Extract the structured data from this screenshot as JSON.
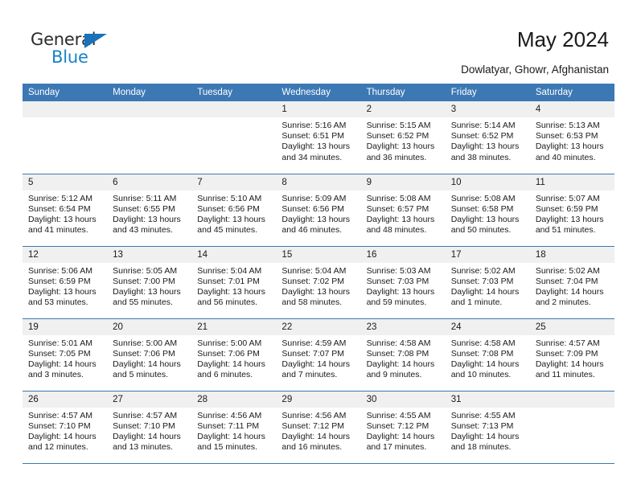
{
  "brand": {
    "name_top": "General",
    "name_bottom": "Blue",
    "accent_color": "#1683c8",
    "triangle_color": "#1972ba"
  },
  "header": {
    "title": "May 2024",
    "subtitle": "Dowlatyar, Ghowr, Afghanistan"
  },
  "calendar": {
    "header_bg": "#3c78b4",
    "daynum_bg": "#f0f0f0",
    "weekday_headers": [
      "Sunday",
      "Monday",
      "Tuesday",
      "Wednesday",
      "Thursday",
      "Friday",
      "Saturday"
    ],
    "weeks": [
      [
        {
          "day": "",
          "lines": []
        },
        {
          "day": "",
          "lines": []
        },
        {
          "day": "",
          "lines": []
        },
        {
          "day": "1",
          "lines": [
            "Sunrise: 5:16 AM",
            "Sunset: 6:51 PM",
            "Daylight: 13 hours",
            "and 34 minutes."
          ]
        },
        {
          "day": "2",
          "lines": [
            "Sunrise: 5:15 AM",
            "Sunset: 6:52 PM",
            "Daylight: 13 hours",
            "and 36 minutes."
          ]
        },
        {
          "day": "3",
          "lines": [
            "Sunrise: 5:14 AM",
            "Sunset: 6:52 PM",
            "Daylight: 13 hours",
            "and 38 minutes."
          ]
        },
        {
          "day": "4",
          "lines": [
            "Sunrise: 5:13 AM",
            "Sunset: 6:53 PM",
            "Daylight: 13 hours",
            "and 40 minutes."
          ]
        }
      ],
      [
        {
          "day": "5",
          "lines": [
            "Sunrise: 5:12 AM",
            "Sunset: 6:54 PM",
            "Daylight: 13 hours",
            "and 41 minutes."
          ]
        },
        {
          "day": "6",
          "lines": [
            "Sunrise: 5:11 AM",
            "Sunset: 6:55 PM",
            "Daylight: 13 hours",
            "and 43 minutes."
          ]
        },
        {
          "day": "7",
          "lines": [
            "Sunrise: 5:10 AM",
            "Sunset: 6:56 PM",
            "Daylight: 13 hours",
            "and 45 minutes."
          ]
        },
        {
          "day": "8",
          "lines": [
            "Sunrise: 5:09 AM",
            "Sunset: 6:56 PM",
            "Daylight: 13 hours",
            "and 46 minutes."
          ]
        },
        {
          "day": "9",
          "lines": [
            "Sunrise: 5:08 AM",
            "Sunset: 6:57 PM",
            "Daylight: 13 hours",
            "and 48 minutes."
          ]
        },
        {
          "day": "10",
          "lines": [
            "Sunrise: 5:08 AM",
            "Sunset: 6:58 PM",
            "Daylight: 13 hours",
            "and 50 minutes."
          ]
        },
        {
          "day": "11",
          "lines": [
            "Sunrise: 5:07 AM",
            "Sunset: 6:59 PM",
            "Daylight: 13 hours",
            "and 51 minutes."
          ]
        }
      ],
      [
        {
          "day": "12",
          "lines": [
            "Sunrise: 5:06 AM",
            "Sunset: 6:59 PM",
            "Daylight: 13 hours",
            "and 53 minutes."
          ]
        },
        {
          "day": "13",
          "lines": [
            "Sunrise: 5:05 AM",
            "Sunset: 7:00 PM",
            "Daylight: 13 hours",
            "and 55 minutes."
          ]
        },
        {
          "day": "14",
          "lines": [
            "Sunrise: 5:04 AM",
            "Sunset: 7:01 PM",
            "Daylight: 13 hours",
            "and 56 minutes."
          ]
        },
        {
          "day": "15",
          "lines": [
            "Sunrise: 5:04 AM",
            "Sunset: 7:02 PM",
            "Daylight: 13 hours",
            "and 58 minutes."
          ]
        },
        {
          "day": "16",
          "lines": [
            "Sunrise: 5:03 AM",
            "Sunset: 7:03 PM",
            "Daylight: 13 hours",
            "and 59 minutes."
          ]
        },
        {
          "day": "17",
          "lines": [
            "Sunrise: 5:02 AM",
            "Sunset: 7:03 PM",
            "Daylight: 14 hours",
            "and 1 minute."
          ]
        },
        {
          "day": "18",
          "lines": [
            "Sunrise: 5:02 AM",
            "Sunset: 7:04 PM",
            "Daylight: 14 hours",
            "and 2 minutes."
          ]
        }
      ],
      [
        {
          "day": "19",
          "lines": [
            "Sunrise: 5:01 AM",
            "Sunset: 7:05 PM",
            "Daylight: 14 hours",
            "and 3 minutes."
          ]
        },
        {
          "day": "20",
          "lines": [
            "Sunrise: 5:00 AM",
            "Sunset: 7:06 PM",
            "Daylight: 14 hours",
            "and 5 minutes."
          ]
        },
        {
          "day": "21",
          "lines": [
            "Sunrise: 5:00 AM",
            "Sunset: 7:06 PM",
            "Daylight: 14 hours",
            "and 6 minutes."
          ]
        },
        {
          "day": "22",
          "lines": [
            "Sunrise: 4:59 AM",
            "Sunset: 7:07 PM",
            "Daylight: 14 hours",
            "and 7 minutes."
          ]
        },
        {
          "day": "23",
          "lines": [
            "Sunrise: 4:58 AM",
            "Sunset: 7:08 PM",
            "Daylight: 14 hours",
            "and 9 minutes."
          ]
        },
        {
          "day": "24",
          "lines": [
            "Sunrise: 4:58 AM",
            "Sunset: 7:08 PM",
            "Daylight: 14 hours",
            "and 10 minutes."
          ]
        },
        {
          "day": "25",
          "lines": [
            "Sunrise: 4:57 AM",
            "Sunset: 7:09 PM",
            "Daylight: 14 hours",
            "and 11 minutes."
          ]
        }
      ],
      [
        {
          "day": "26",
          "lines": [
            "Sunrise: 4:57 AM",
            "Sunset: 7:10 PM",
            "Daylight: 14 hours",
            "and 12 minutes."
          ]
        },
        {
          "day": "27",
          "lines": [
            "Sunrise: 4:57 AM",
            "Sunset: 7:10 PM",
            "Daylight: 14 hours",
            "and 13 minutes."
          ]
        },
        {
          "day": "28",
          "lines": [
            "Sunrise: 4:56 AM",
            "Sunset: 7:11 PM",
            "Daylight: 14 hours",
            "and 15 minutes."
          ]
        },
        {
          "day": "29",
          "lines": [
            "Sunrise: 4:56 AM",
            "Sunset: 7:12 PM",
            "Daylight: 14 hours",
            "and 16 minutes."
          ]
        },
        {
          "day": "30",
          "lines": [
            "Sunrise: 4:55 AM",
            "Sunset: 7:12 PM",
            "Daylight: 14 hours",
            "and 17 minutes."
          ]
        },
        {
          "day": "31",
          "lines": [
            "Sunrise: 4:55 AM",
            "Sunset: 7:13 PM",
            "Daylight: 14 hours",
            "and 18 minutes."
          ]
        },
        {
          "day": "",
          "lines": []
        }
      ]
    ]
  }
}
